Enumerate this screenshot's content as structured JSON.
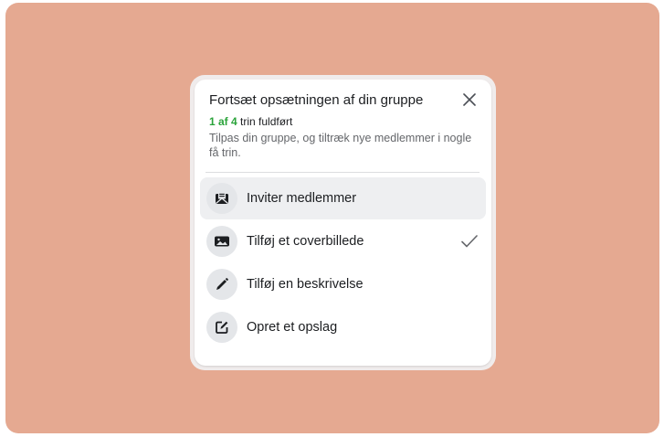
{
  "dialog": {
    "title": "Fortsæt opsætningen af din gruppe",
    "progress_count": "1 af 4",
    "progress_suffix": "trin fuldført",
    "description": "Tilpas din gruppe, og tiltræk nye medlemmer i nogle få trin."
  },
  "steps": [
    {
      "label": "Inviter medlemmer",
      "icon": "invite-envelope-icon",
      "completed": false
    },
    {
      "label": "Tilføj et coverbillede",
      "icon": "image-icon",
      "completed": true
    },
    {
      "label": "Tilføj en beskrivelse",
      "icon": "pencil-icon",
      "completed": false
    },
    {
      "label": "Opret et opslag",
      "icon": "edit-post-icon",
      "completed": false
    }
  ],
  "colors": {
    "background": "#e5a991",
    "progress_green": "#2aa33a",
    "hover_row": "#eeeff1"
  }
}
